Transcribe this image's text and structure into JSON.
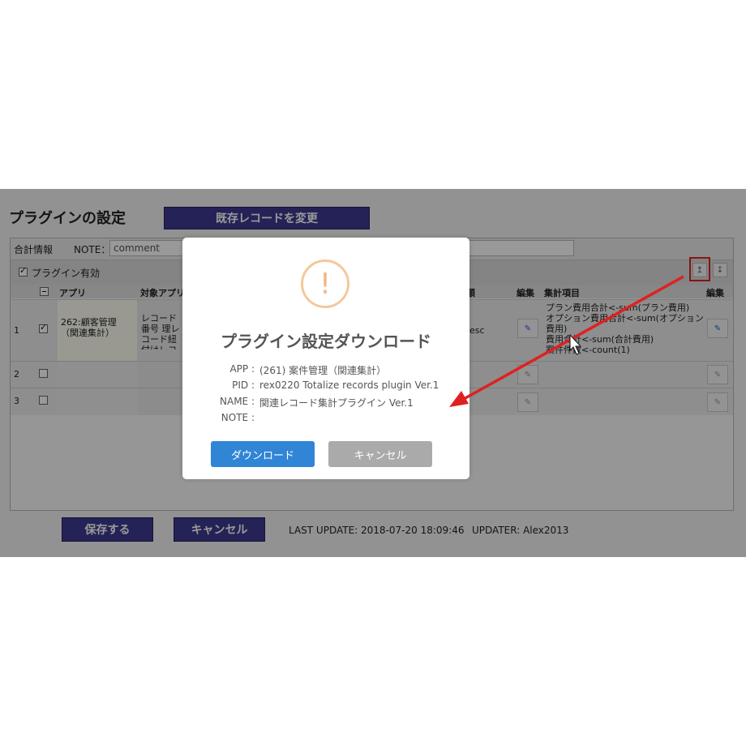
{
  "page": {
    "title": "プラグインの設定",
    "change_record_button": "既存レコードを変更"
  },
  "settings": {
    "group_label": "合計情報",
    "note_label": "NOTE：",
    "note_value": "comment",
    "plugin_enabled_label": "プラグイン有効",
    "plugin_enabled": true,
    "export_icon": "↥",
    "import_icon": "↧"
  },
  "table": {
    "headers": {
      "app": "アプリ",
      "target_app": "対象アプリ",
      "sort": "順",
      "edit": "編集",
      "totals": "集計項目",
      "edit2": "編集"
    },
    "rows": [
      {
        "num": "1",
        "checked": true,
        "app": "262:顧客管理（関連集計）",
        "target_app": "レコード番号 理レコード紐付けレコード紐付け",
        "sort": "esc",
        "totals": "プラン費用合計<-sum(プラン費用)\nオプション費用合計<-sum(オプション費用)\n費用合計<-sum(合計費用)\n案件件数<-count(1)"
      },
      {
        "num": "2",
        "checked": false
      },
      {
        "num": "3",
        "checked": false
      }
    ]
  },
  "footer": {
    "save_button": "保存する",
    "cancel_button": "キャンセル",
    "last_update": "LAST UPDATE: 2018-07-20 18:09:46",
    "updater": "UPDATER: Alex2013"
  },
  "dialog": {
    "icon": "!",
    "title": "プラグイン設定ダウンロード",
    "fields": [
      {
        "key": "APP :",
        "value": "(261) 案件管理（関連集計）"
      },
      {
        "key": "PID :",
        "value": "rex0220 Totalize records plugin Ver.1"
      },
      {
        "key": "NAME :",
        "value": "関連レコード集計プラグイン Ver.1"
      },
      {
        "key": "NOTE :",
        "value": ""
      }
    ],
    "download_button": "ダウンロード",
    "cancel_button": "キャンセル"
  },
  "colors": {
    "navy_button": "#3c3a8f",
    "primary_button": "#3085d6",
    "secondary_button": "#aaaaaa",
    "warning_icon": "#f4c89c",
    "annotation_red": "#e02020"
  }
}
